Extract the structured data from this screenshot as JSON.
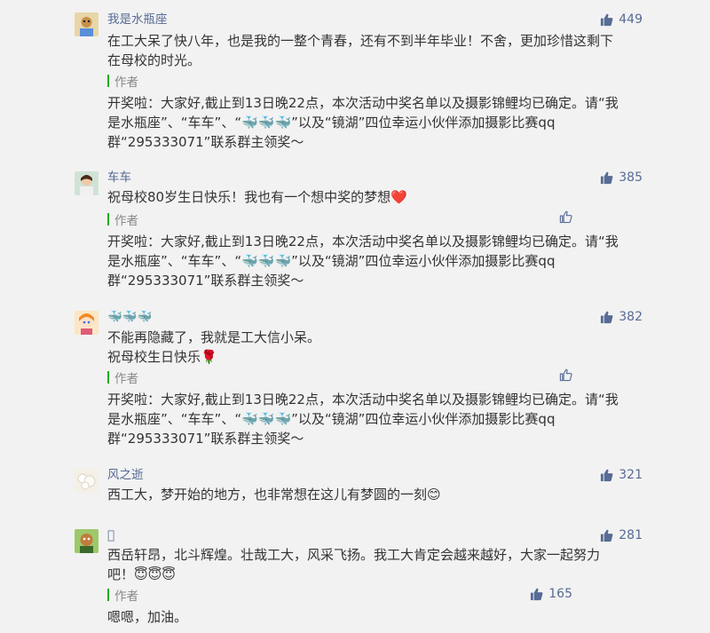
{
  "comments": [
    {
      "nickname": "我是水瓶座",
      "likes": "449",
      "avatar_icon": "cartoon-avatar-icon",
      "lines": [
        "在工大呆了快八年，也是我的一整个青春，还有不到半年毕业！不舍，更加珍惜这剩下",
        "在母校的时光。"
      ],
      "reply": {
        "author": "作者",
        "lines": [
          "开奖啦：大家好,截止到13日晚22点，本次活动中奖名单以及摄影锦鲤均已确定。请“我",
          "是水瓶座”、“车车”、“🐳🐳🐳”以及“镜湖”四位幸运小伙伴添加摄影比赛qq",
          "群“295333071”联系群主领奖～"
        ]
      }
    },
    {
      "nickname": "车车",
      "likes": "385",
      "avatar_icon": "girl-avatar-icon",
      "lines": [
        "祝母校80岁生日快乐！我也有一个想中奖的梦想❤️"
      ],
      "reply": {
        "author": "作者",
        "lines": [
          "开奖啦：大家好,截止到13日晚22点，本次活动中奖名单以及摄影锦鲤均已确定。请“我",
          "是水瓶座”、“车车”、“🐳🐳🐳”以及“镜湖”四位幸运小伙伴添加摄影比赛qq",
          "群“295333071”联系群主领奖～"
        ]
      }
    },
    {
      "nickname": "🐳🐳🐳",
      "likes": "382",
      "avatar_icon": "anime-avatar-icon",
      "lines": [
        "不能再隐藏了，我就是工大信小呆。",
        "祝母校生日快乐🌹"
      ],
      "reply": {
        "author": "作者",
        "lines": [
          "开奖啦：大家好,截止到13日晚22点，本次活动中奖名单以及摄影锦鲤均已确定。请“我",
          "是水瓶座”、“车车”、“🐳🐳🐳”以及“镜湖”四位幸运小伙伴添加摄影比赛qq",
          "群“295333071”联系群主领奖～"
        ]
      }
    },
    {
      "nickname": "风之逝",
      "likes": "321",
      "avatar_icon": "flower-avatar-icon",
      "lines": [
        "西工大，梦开始的地方，也非常想在这儿有梦圆的一刻😊"
      ]
    },
    {
      "nickname": "􏰀",
      "likes": "281",
      "avatar_icon": "cartoon-character-avatar-icon",
      "lines": [
        "西岳轩昂，北斗辉煌。壮哉工大，风采飞扬。我工大肯定会越来越好，大家一起努力",
        "吧！😇😇😇"
      ],
      "reply": {
        "author": "作者",
        "likes": "165",
        "lines": [
          "嗯嗯，加油。"
        ]
      }
    }
  ],
  "colors": {
    "link": "#576b95",
    "author_bar": "#1aad19",
    "background": "#f2f2f2"
  }
}
